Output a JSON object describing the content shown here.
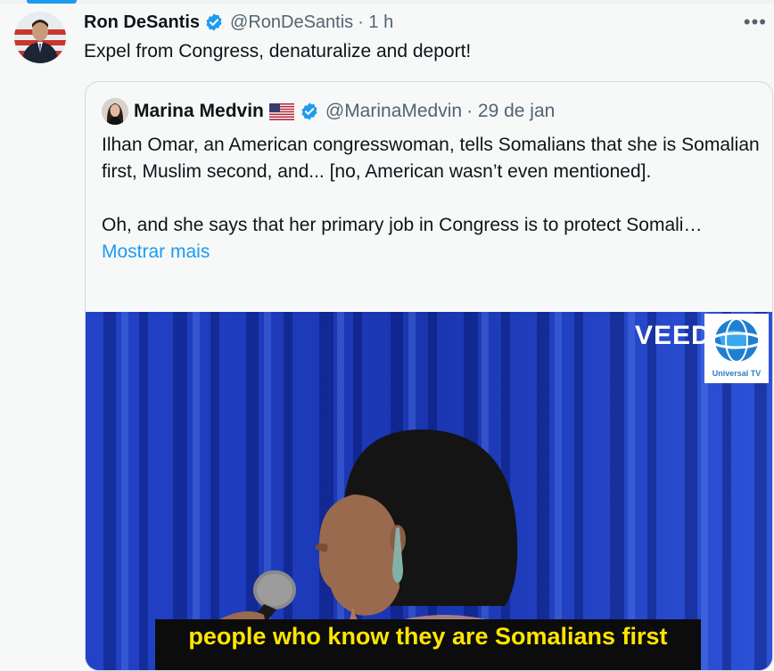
{
  "tweet": {
    "author_name": "Ron DeSantis",
    "handle": "@RonDeSantis",
    "time": "· 1 h",
    "more_icon": "more-horizontal-icon",
    "text": "Expel from Congress, denaturalize and deport!"
  },
  "quote": {
    "author_name": "Marina Medvin",
    "handle": "@MarinaMedvin",
    "date": "· 29 de jan",
    "paragraph1": "Ilhan Omar, an American congresswoman, tells Somalians that she is Somalian first, Muslim second, and... [no, American wasn’t even mentioned].",
    "paragraph2": "Oh, and she says that her primary job in Congress is to protect Somali…",
    "show_more": "Mostrar mais"
  },
  "media": {
    "watermark": "VEED",
    "watermark_badge": "Universal TV",
    "caption": "people who know they are Somalians first"
  },
  "colors": {
    "accent": "#1d9bf0",
    "text": "#0f1419",
    "muted": "#536471",
    "caption_text": "#ffe500"
  }
}
